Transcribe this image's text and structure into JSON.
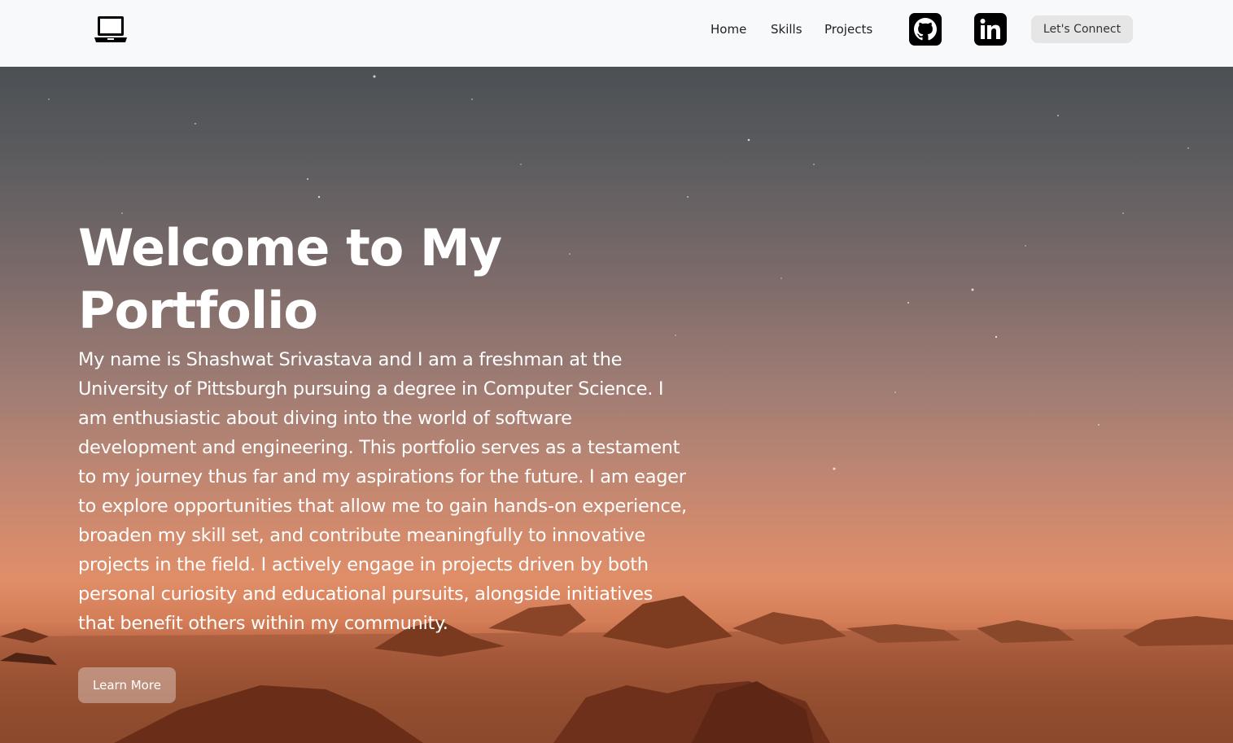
{
  "nav": {
    "logo_icon": "laptop-icon",
    "links": {
      "home": "Home",
      "skills": "Skills",
      "projects": "Projects"
    },
    "github_icon": "github-icon",
    "linkedin_icon": "linkedin-icon",
    "connect_label": "Let's Connect"
  },
  "hero": {
    "title": "Welcome to My Portfolio",
    "description": "My name is Shashwat Srivastava and I am a freshman at the University of Pittsburgh pursuing a degree in Computer Science. I am enthusiastic about diving into the world of software development and engineering. This portfolio serves as a testament to my journey thus far and my aspirations for the future. I am eager to explore opportunities that allow me to gain hands-on experience, broaden my skill set, and contribute meaningfully to innovative projects in the field. I actively engage in projects driven by both personal curiosity and educational pursuits, alongside initiatives that benefit others within my community.",
    "button_label": "Learn More",
    "background": "desert-night-sky-image"
  },
  "colors": {
    "navbar_bg": "#f8f9fa",
    "icon_bg": "#000000",
    "connect_bg": "#e6e6e6"
  }
}
